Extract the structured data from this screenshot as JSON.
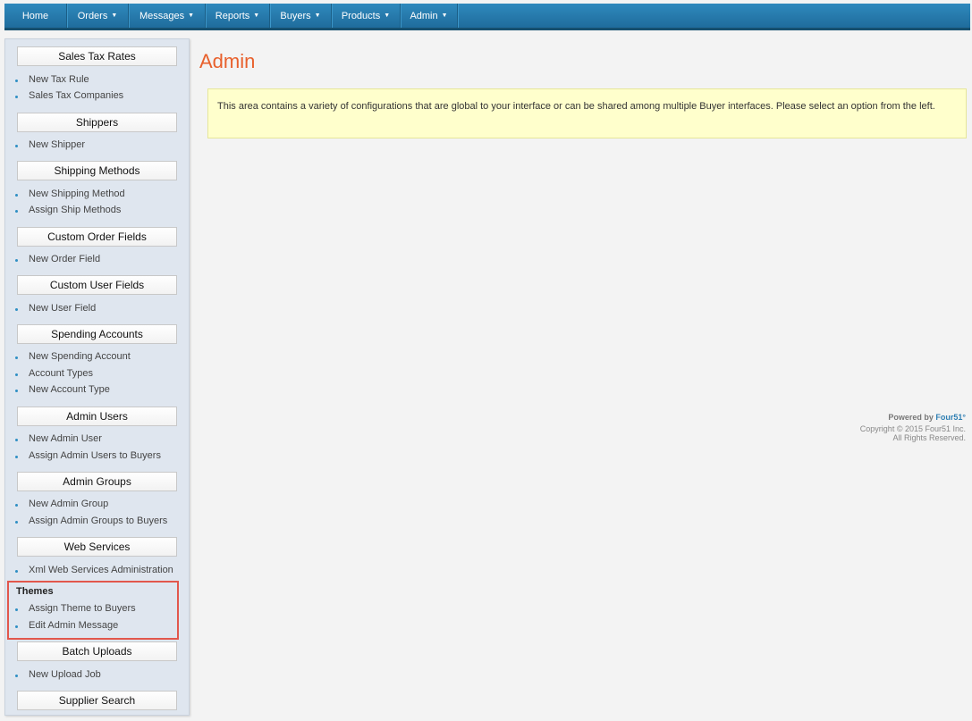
{
  "nav": {
    "items": [
      {
        "label": "Home",
        "dropdown": false
      },
      {
        "label": "Orders",
        "dropdown": true
      },
      {
        "label": "Messages",
        "dropdown": true
      },
      {
        "label": "Reports",
        "dropdown": true
      },
      {
        "label": "Buyers",
        "dropdown": true
      },
      {
        "label": "Products",
        "dropdown": true
      },
      {
        "label": "Admin",
        "dropdown": true
      }
    ],
    "caret": "▼"
  },
  "sidebar": {
    "sales_tax_rates": "Sales Tax Rates",
    "new_tax_rule": "New Tax Rule",
    "sales_tax_companies": "Sales Tax Companies",
    "shippers": "Shippers",
    "new_shipper": "New Shipper",
    "shipping_methods": "Shipping Methods",
    "new_shipping_method": "New Shipping Method",
    "assign_ship_methods": "Assign Ship Methods",
    "custom_order_fields": "Custom Order Fields",
    "new_order_field": "New Order Field",
    "custom_user_fields": "Custom User Fields",
    "new_user_field": "New User Field",
    "spending_accounts": "Spending Accounts",
    "new_spending_account": "New Spending Account",
    "account_types": "Account Types",
    "new_account_type": "New Account Type",
    "admin_users": "Admin Users",
    "new_admin_user": "New Admin User",
    "assign_admin_users": "Assign Admin Users to Buyers",
    "admin_groups": "Admin Groups",
    "new_admin_group": "New Admin Group",
    "assign_admin_groups": "Assign Admin Groups to Buyers",
    "web_services": "Web Services",
    "xml_web_services": "Xml Web Services Administration",
    "themes": "Themes",
    "assign_theme": "Assign Theme to Buyers",
    "edit_admin_message": "Edit Admin Message",
    "batch_uploads": "Batch Uploads",
    "new_upload_job": "New Upload Job",
    "supplier_search": "Supplier Search"
  },
  "main": {
    "title": "Admin",
    "info": "This area contains a variety of configurations that are global to your interface or can be shared among multiple Buyer interfaces. Please select an option from the left."
  },
  "footer": {
    "powered_by": "Powered by ",
    "brand": "Four51°",
    "copyright": "Copyright © 2015 Four51 Inc.",
    "rights": "All Rights Reserved."
  },
  "colors": {
    "nav_bg": "#2f89bd",
    "title": "#e8602c",
    "highlight_border": "#e2574c",
    "info_bg": "#ffffcc"
  }
}
